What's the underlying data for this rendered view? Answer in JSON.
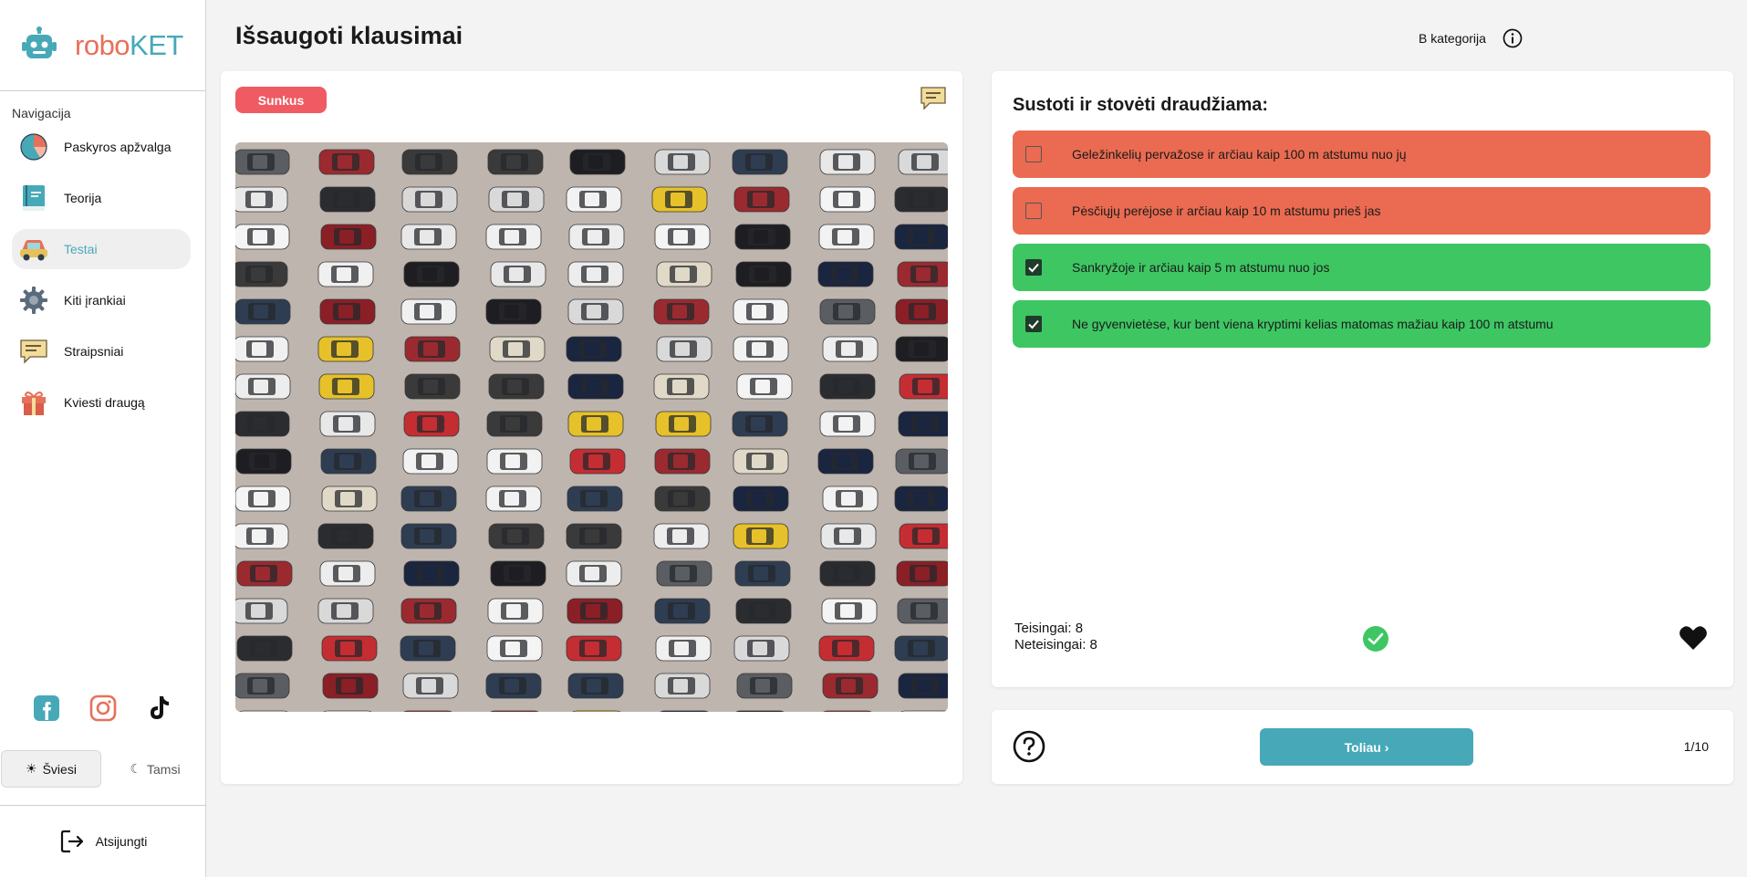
{
  "brand": {
    "part1": "robo",
    "part2": "KET",
    "icon": "robot-icon",
    "colors": {
      "part1": "#e6715a",
      "part2": "#47a9b8"
    }
  },
  "sidebar": {
    "nav_title": "Navigacija",
    "items": [
      {
        "label": "Paskyros apžvalga",
        "icon": "pie-chart-icon"
      },
      {
        "label": "Teorija",
        "icon": "book-icon"
      },
      {
        "label": "Testai",
        "icon": "car-icon",
        "active": true
      },
      {
        "label": "Kiti įrankiai",
        "icon": "gear-icon"
      },
      {
        "label": "Straipsniai",
        "icon": "speech-bubble-icon"
      },
      {
        "label": "Kviesti draugą",
        "icon": "gift-icon"
      }
    ],
    "socials": [
      "facebook-icon",
      "instagram-icon",
      "tiktok-icon"
    ],
    "theme": {
      "light": "Šviesi",
      "dark": "Tamsi",
      "selected": "light"
    },
    "logout": "Atsijungti"
  },
  "header": {
    "title": "Išsaugoti klausimai",
    "category": "B kategorija"
  },
  "question_card": {
    "difficulty": "Sunkus",
    "image": "aerial-car-parking-lot"
  },
  "answers_card": {
    "question": "Sustoti ir stovėti draudžiama:",
    "answers": [
      {
        "text": "Geležinkelių pervažose ir arčiau kaip 100 m atstumu nuo jų",
        "state": "wrong",
        "checked": false
      },
      {
        "text": "Pėsčiųjų perėjose ir arčiau kaip 10 m atstumu prieš jas",
        "state": "wrong",
        "checked": false
      },
      {
        "text": "Sankryžoje ir arčiau kaip 5 m atstumu nuo jos",
        "state": "correct",
        "checked": true
      },
      {
        "text": "Ne gyvenvietėse, kur bent viena kryptimi kelias matomas mažiau kaip 100 m atstumu",
        "state": "correct",
        "checked": true
      }
    ],
    "correct_label": "Teisingai: 8",
    "incorrect_label": "Neteisingai: 8",
    "colors": {
      "wrong": "#ea6b51",
      "correct": "#3ec663"
    }
  },
  "footer_card": {
    "next_label": "Toliau ›",
    "pager": "1/10"
  }
}
